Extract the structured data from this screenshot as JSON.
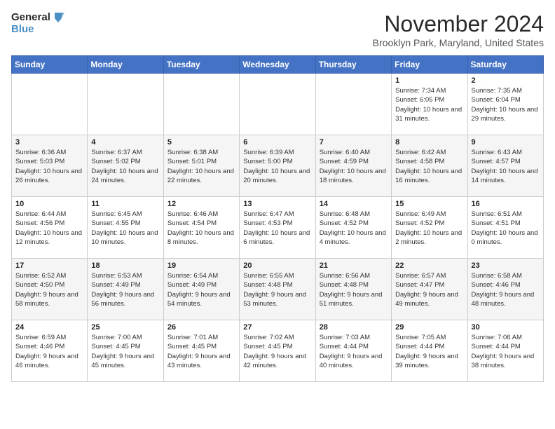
{
  "logo": {
    "line1": "General",
    "line2": "Blue"
  },
  "title": "November 2024",
  "location": "Brooklyn Park, Maryland, United States",
  "weekdays": [
    "Sunday",
    "Monday",
    "Tuesday",
    "Wednesday",
    "Thursday",
    "Friday",
    "Saturday"
  ],
  "weeks": [
    [
      {
        "day": "",
        "info": ""
      },
      {
        "day": "",
        "info": ""
      },
      {
        "day": "",
        "info": ""
      },
      {
        "day": "",
        "info": ""
      },
      {
        "day": "",
        "info": ""
      },
      {
        "day": "1",
        "info": "Sunrise: 7:34 AM\nSunset: 6:05 PM\nDaylight: 10 hours and 31 minutes."
      },
      {
        "day": "2",
        "info": "Sunrise: 7:35 AM\nSunset: 6:04 PM\nDaylight: 10 hours and 29 minutes."
      }
    ],
    [
      {
        "day": "3",
        "info": "Sunrise: 6:36 AM\nSunset: 5:03 PM\nDaylight: 10 hours and 26 minutes."
      },
      {
        "day": "4",
        "info": "Sunrise: 6:37 AM\nSunset: 5:02 PM\nDaylight: 10 hours and 24 minutes."
      },
      {
        "day": "5",
        "info": "Sunrise: 6:38 AM\nSunset: 5:01 PM\nDaylight: 10 hours and 22 minutes."
      },
      {
        "day": "6",
        "info": "Sunrise: 6:39 AM\nSunset: 5:00 PM\nDaylight: 10 hours and 20 minutes."
      },
      {
        "day": "7",
        "info": "Sunrise: 6:40 AM\nSunset: 4:59 PM\nDaylight: 10 hours and 18 minutes."
      },
      {
        "day": "8",
        "info": "Sunrise: 6:42 AM\nSunset: 4:58 PM\nDaylight: 10 hours and 16 minutes."
      },
      {
        "day": "9",
        "info": "Sunrise: 6:43 AM\nSunset: 4:57 PM\nDaylight: 10 hours and 14 minutes."
      }
    ],
    [
      {
        "day": "10",
        "info": "Sunrise: 6:44 AM\nSunset: 4:56 PM\nDaylight: 10 hours and 12 minutes."
      },
      {
        "day": "11",
        "info": "Sunrise: 6:45 AM\nSunset: 4:55 PM\nDaylight: 10 hours and 10 minutes."
      },
      {
        "day": "12",
        "info": "Sunrise: 6:46 AM\nSunset: 4:54 PM\nDaylight: 10 hours and 8 minutes."
      },
      {
        "day": "13",
        "info": "Sunrise: 6:47 AM\nSunset: 4:53 PM\nDaylight: 10 hours and 6 minutes."
      },
      {
        "day": "14",
        "info": "Sunrise: 6:48 AM\nSunset: 4:52 PM\nDaylight: 10 hours and 4 minutes."
      },
      {
        "day": "15",
        "info": "Sunrise: 6:49 AM\nSunset: 4:52 PM\nDaylight: 10 hours and 2 minutes."
      },
      {
        "day": "16",
        "info": "Sunrise: 6:51 AM\nSunset: 4:51 PM\nDaylight: 10 hours and 0 minutes."
      }
    ],
    [
      {
        "day": "17",
        "info": "Sunrise: 6:52 AM\nSunset: 4:50 PM\nDaylight: 9 hours and 58 minutes."
      },
      {
        "day": "18",
        "info": "Sunrise: 6:53 AM\nSunset: 4:49 PM\nDaylight: 9 hours and 56 minutes."
      },
      {
        "day": "19",
        "info": "Sunrise: 6:54 AM\nSunset: 4:49 PM\nDaylight: 9 hours and 54 minutes."
      },
      {
        "day": "20",
        "info": "Sunrise: 6:55 AM\nSunset: 4:48 PM\nDaylight: 9 hours and 53 minutes."
      },
      {
        "day": "21",
        "info": "Sunrise: 6:56 AM\nSunset: 4:48 PM\nDaylight: 9 hours and 51 minutes."
      },
      {
        "day": "22",
        "info": "Sunrise: 6:57 AM\nSunset: 4:47 PM\nDaylight: 9 hours and 49 minutes."
      },
      {
        "day": "23",
        "info": "Sunrise: 6:58 AM\nSunset: 4:46 PM\nDaylight: 9 hours and 48 minutes."
      }
    ],
    [
      {
        "day": "24",
        "info": "Sunrise: 6:59 AM\nSunset: 4:46 PM\nDaylight: 9 hours and 46 minutes."
      },
      {
        "day": "25",
        "info": "Sunrise: 7:00 AM\nSunset: 4:45 PM\nDaylight: 9 hours and 45 minutes."
      },
      {
        "day": "26",
        "info": "Sunrise: 7:01 AM\nSunset: 4:45 PM\nDaylight: 9 hours and 43 minutes."
      },
      {
        "day": "27",
        "info": "Sunrise: 7:02 AM\nSunset: 4:45 PM\nDaylight: 9 hours and 42 minutes."
      },
      {
        "day": "28",
        "info": "Sunrise: 7:03 AM\nSunset: 4:44 PM\nDaylight: 9 hours and 40 minutes."
      },
      {
        "day": "29",
        "info": "Sunrise: 7:05 AM\nSunset: 4:44 PM\nDaylight: 9 hours and 39 minutes."
      },
      {
        "day": "30",
        "info": "Sunrise: 7:06 AM\nSunset: 4:44 PM\nDaylight: 9 hours and 38 minutes."
      }
    ]
  ]
}
